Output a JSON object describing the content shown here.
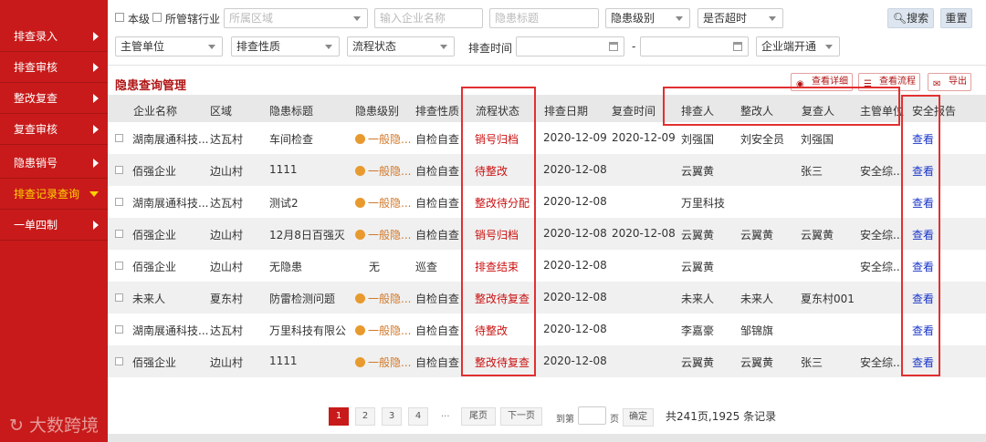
{
  "sidebar": {
    "items": [
      {
        "label": "排查录入"
      },
      {
        "label": "排查审核"
      },
      {
        "label": "整改复查"
      },
      {
        "label": "复查审核"
      },
      {
        "label": "隐患销号"
      },
      {
        "label": "排查记录查询"
      },
      {
        "label": "一单四制"
      }
    ],
    "watermark": "大数跨境"
  },
  "filters": {
    "this_level": "本级",
    "managed_industry": "所管辖行业",
    "region_placeholder": "所属区域",
    "company_placeholder": "输入企业名称",
    "hazard_title_placeholder": "隐患标题",
    "hazard_level": "隐患级别",
    "overtime": "是否超时",
    "search": "搜索",
    "reset": "重置",
    "supervisor": "主管单位",
    "check_nature": "排查性质",
    "flow_status": "流程状态",
    "check_time_label": "排查时间",
    "date_sep": "-",
    "enterprise_app": "企业端开通"
  },
  "section": {
    "title": "隐患查询管理",
    "view_detail": "查看详细",
    "view_flow": "查看流程",
    "export": "导出"
  },
  "table": {
    "headers": [
      "企业名称",
      "区域",
      "隐患标题",
      "隐患级别",
      "排查性质",
      "流程状态",
      "排查日期",
      "复查时间",
      "排查人",
      "整改人",
      "复查人",
      "主管单位",
      "安全报告"
    ],
    "rows": [
      {
        "company": "湖南展通科技...",
        "region": "达瓦村",
        "title": "车间检查",
        "level": "一般隐...",
        "nature": "自检自查",
        "status": "销号归档",
        "check_date": "2020-12-09",
        "review_time": "2020-12-09",
        "checker": "刘强国",
        "rectifier": "刘安全员",
        "reviewer": "刘强国",
        "supervisor": "",
        "report": "查看"
      },
      {
        "company": "佰强企业",
        "region": "边山村",
        "title": "1111",
        "level": "一般隐...",
        "nature": "自检自查",
        "status": "待整改",
        "check_date": "2020-12-08",
        "review_time": "",
        "checker": "云翼黄",
        "rectifier": "",
        "reviewer": "张三",
        "supervisor": "安全综...",
        "report": "查看"
      },
      {
        "company": "湖南展通科技...",
        "region": "达瓦村",
        "title": "测试2",
        "level": "一般隐...",
        "nature": "自检自查",
        "status": "整改待分配",
        "check_date": "2020-12-08",
        "review_time": "",
        "checker": "万里科技",
        "rectifier": "",
        "reviewer": "",
        "supervisor": "",
        "report": "查看"
      },
      {
        "company": "佰强企业",
        "region": "边山村",
        "title": "12月8日百强灭...",
        "level": "一般隐...",
        "nature": "自检自查",
        "status": "销号归档",
        "check_date": "2020-12-08",
        "review_time": "2020-12-08",
        "checker": "云翼黄",
        "rectifier": "云翼黄",
        "reviewer": "云翼黄",
        "supervisor": "安全综...",
        "report": "查看"
      },
      {
        "company": "佰强企业",
        "region": "边山村",
        "title": "无隐患",
        "level": "无",
        "nature": "巡查",
        "status": "排查结束",
        "check_date": "2020-12-08",
        "review_time": "",
        "checker": "云翼黄",
        "rectifier": "",
        "reviewer": "",
        "supervisor": "安全综...",
        "report": "查看"
      },
      {
        "company": "未来人",
        "region": "夏东村",
        "title": "防雷检测问题",
        "level": "一般隐...",
        "nature": "自检自查",
        "status": "整改待复查",
        "check_date": "2020-12-08",
        "review_time": "",
        "checker": "未来人",
        "rectifier": "未来人",
        "reviewer": "夏东村001",
        "supervisor": "",
        "report": "查看"
      },
      {
        "company": "湖南展通科技...",
        "region": "达瓦村",
        "title": "万里科技有限公...",
        "level": "一般隐...",
        "nature": "自检自查",
        "status": "待整改",
        "check_date": "2020-12-08",
        "review_time": "",
        "checker": "李嘉豪",
        "rectifier": "邹锦旗",
        "reviewer": "",
        "supervisor": "",
        "report": "查看"
      },
      {
        "company": "佰强企业",
        "region": "边山村",
        "title": "1111",
        "level": "一般隐...",
        "nature": "自检自查",
        "status": "整改待复查",
        "check_date": "2020-12-08",
        "review_time": "",
        "checker": "云翼黄",
        "rectifier": "云翼黄",
        "reviewer": "张三",
        "supervisor": "安全综...",
        "report": "查看"
      }
    ]
  },
  "pagination": {
    "pages": [
      "1",
      "2",
      "3",
      "4"
    ],
    "ellipsis": "...",
    "last": "尾页",
    "next": "下一页",
    "goto": "到第",
    "page_unit": "页",
    "confirm": "确定",
    "total": "共241页,1925 条记录"
  },
  "colors": {
    "sidebar": "#c81a1a",
    "accent": "#b01515",
    "status": "#cc1111",
    "link": "#1a36c8",
    "level_dot": "#e89a2e"
  }
}
